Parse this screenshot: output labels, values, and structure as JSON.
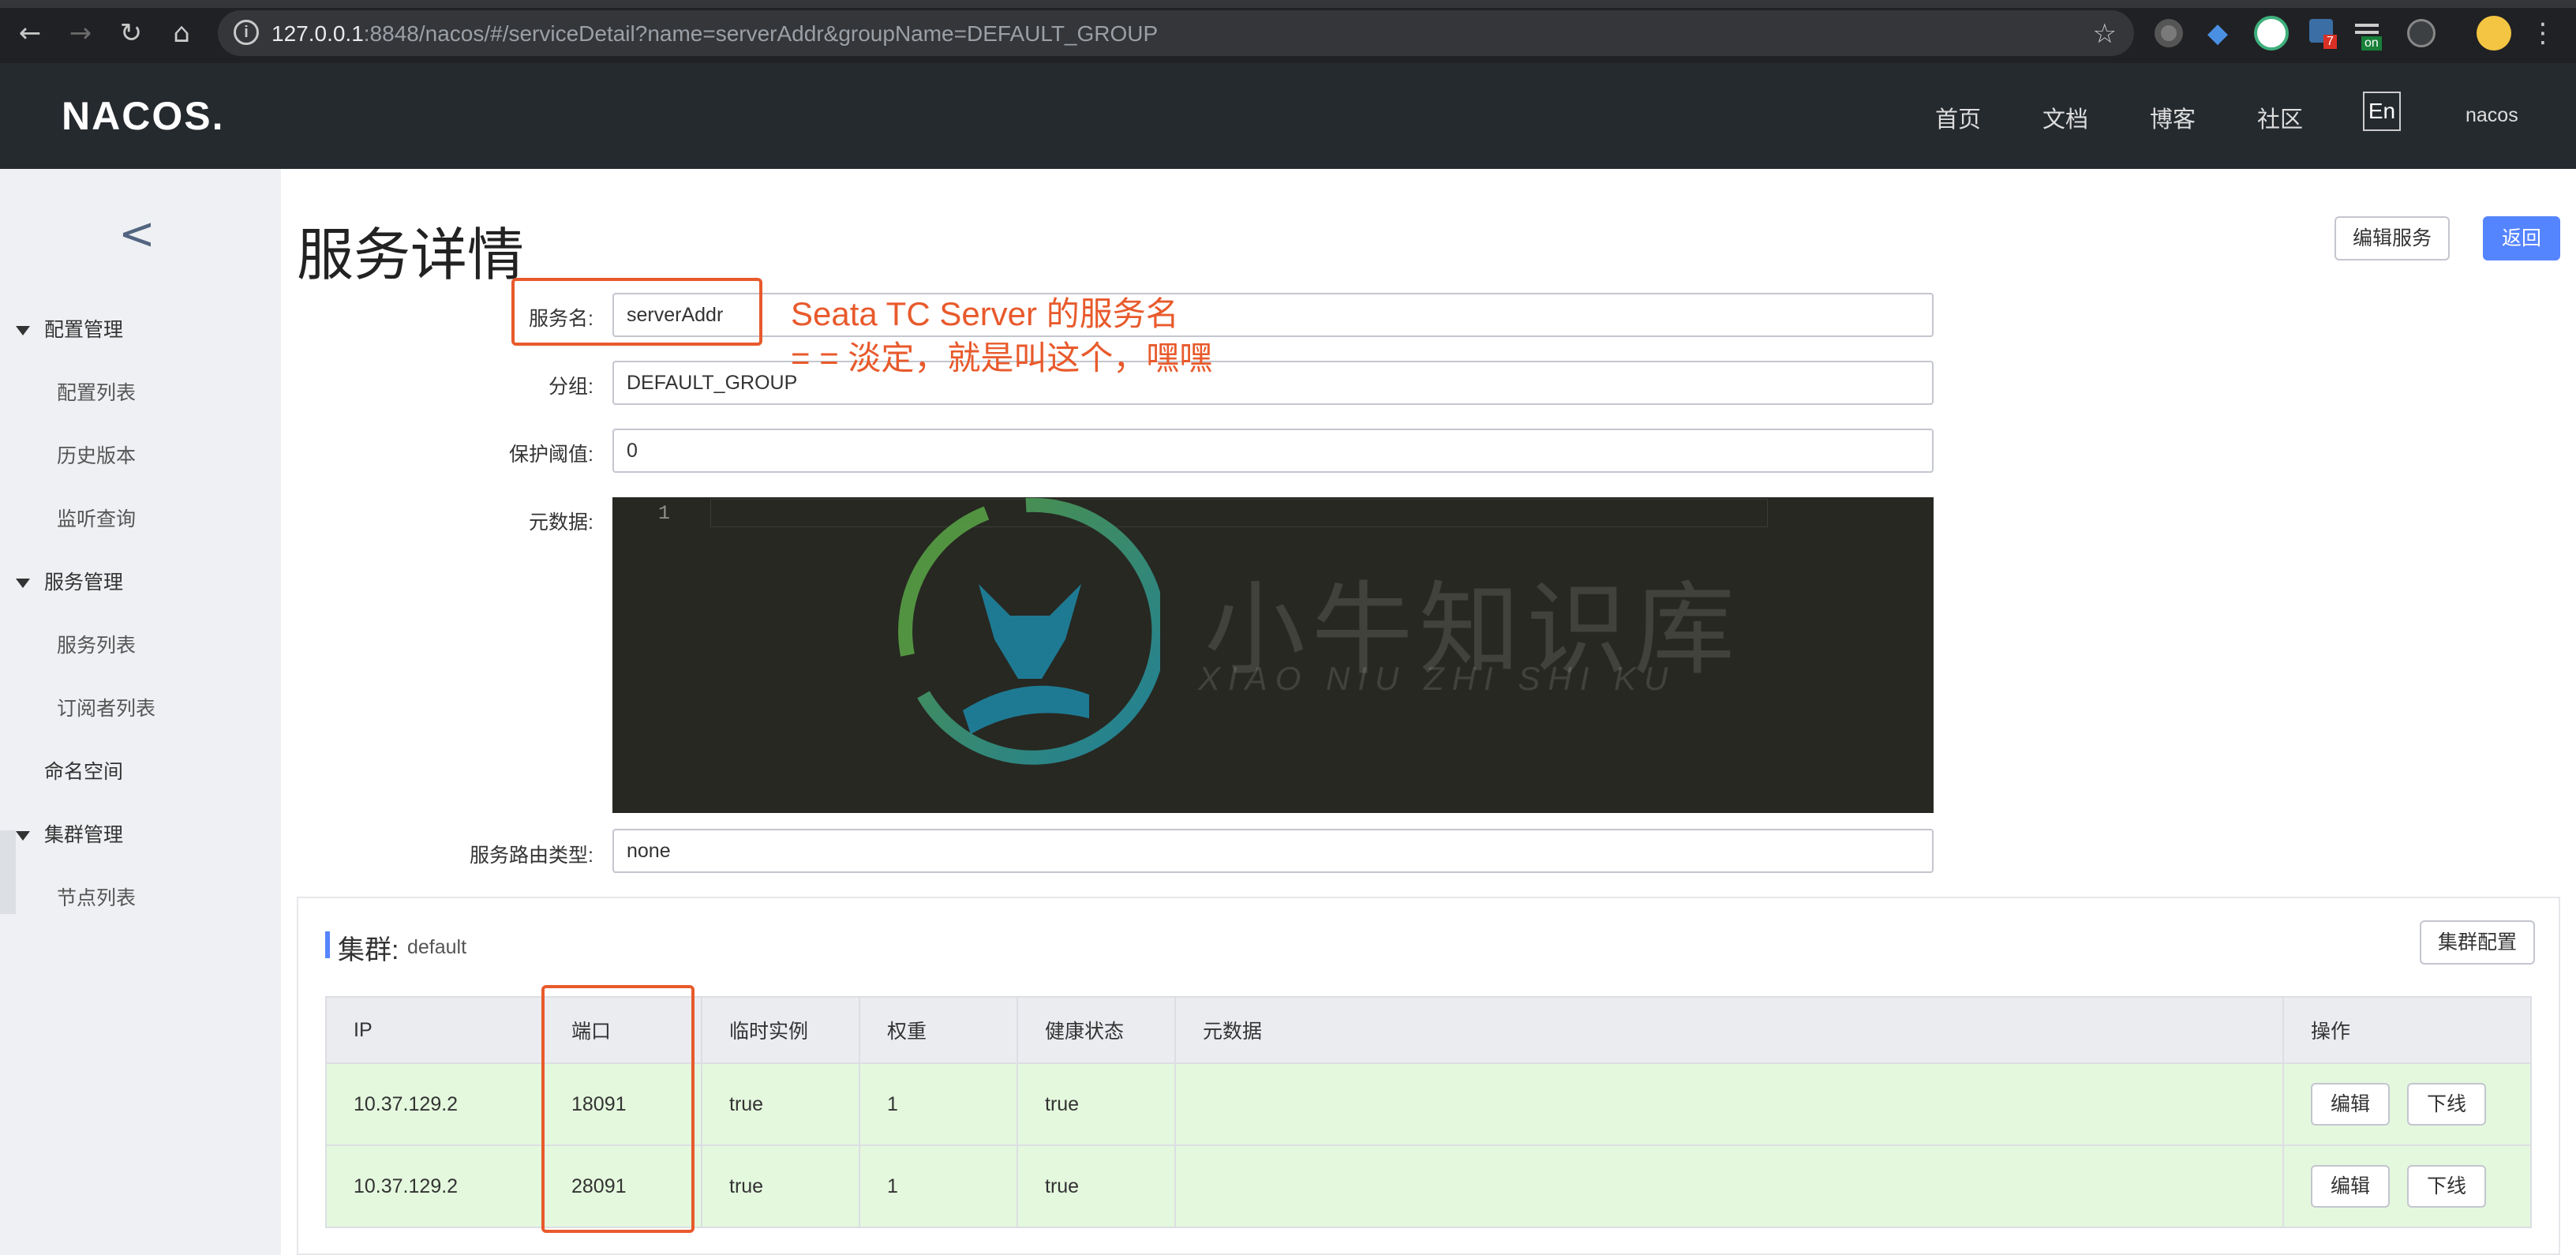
{
  "browser": {
    "url_host": "127.0.0.1",
    "url_rest": ":8848/nacos/#/serviceDetail?name=serverAddr&groupName=DEFAULT_GROUP",
    "ext_badge_1": "7",
    "ext_badge_2": "on"
  },
  "header": {
    "logo": "NACOS.",
    "nav": [
      "首页",
      "文档",
      "博客",
      "社区"
    ],
    "lang": "En",
    "user": "nacos"
  },
  "sidebar": {
    "groups": [
      {
        "label": "配置管理",
        "items": [
          "配置列表",
          "历史版本",
          "监听查询"
        ]
      },
      {
        "label": "服务管理",
        "items": [
          "服务列表",
          "订阅者列表"
        ]
      },
      {
        "label": "命名空间",
        "items": []
      },
      {
        "label": "集群管理",
        "items": [
          "节点列表"
        ]
      }
    ]
  },
  "page": {
    "title": "服务详情",
    "edit_service": "编辑服务",
    "back": "返回"
  },
  "form": {
    "service_name_label": "服务名:",
    "service_name": "serverAddr",
    "group_label": "分组:",
    "group": "DEFAULT_GROUP",
    "threshold_label": "保护阈值:",
    "threshold": "0",
    "metadata_label": "元数据:",
    "metadata_line_no": "1",
    "route_label": "服务路由类型:",
    "route_type": "none"
  },
  "annotation": {
    "line1": "Seata TC Server 的服务名",
    "line2": "= = 淡定，就是叫这个，嘿嘿"
  },
  "watermark": {
    "title": "小牛知识库",
    "subtitle": "XIAO NIU ZHI SHI KU"
  },
  "cluster": {
    "title": "集群:",
    "name": "default",
    "config_button": "集群配置",
    "columns": [
      "IP",
      "端口",
      "临时实例",
      "权重",
      "健康状态",
      "元数据",
      "操作"
    ],
    "rows": [
      {
        "ip": "10.37.129.2",
        "port": "18091",
        "ephemeral": "true",
        "weight": "1",
        "healthy": "true",
        "metadata": ""
      },
      {
        "ip": "10.37.129.2",
        "port": "28091",
        "ephemeral": "true",
        "weight": "1",
        "healthy": "true",
        "metadata": ""
      }
    ],
    "edit": "编辑",
    "offline": "下线"
  },
  "colors": {
    "accent": "#5584ff",
    "annotation": "#e85a2c",
    "header_bg": "#252a2f",
    "row_bg": "#e4f8de"
  }
}
